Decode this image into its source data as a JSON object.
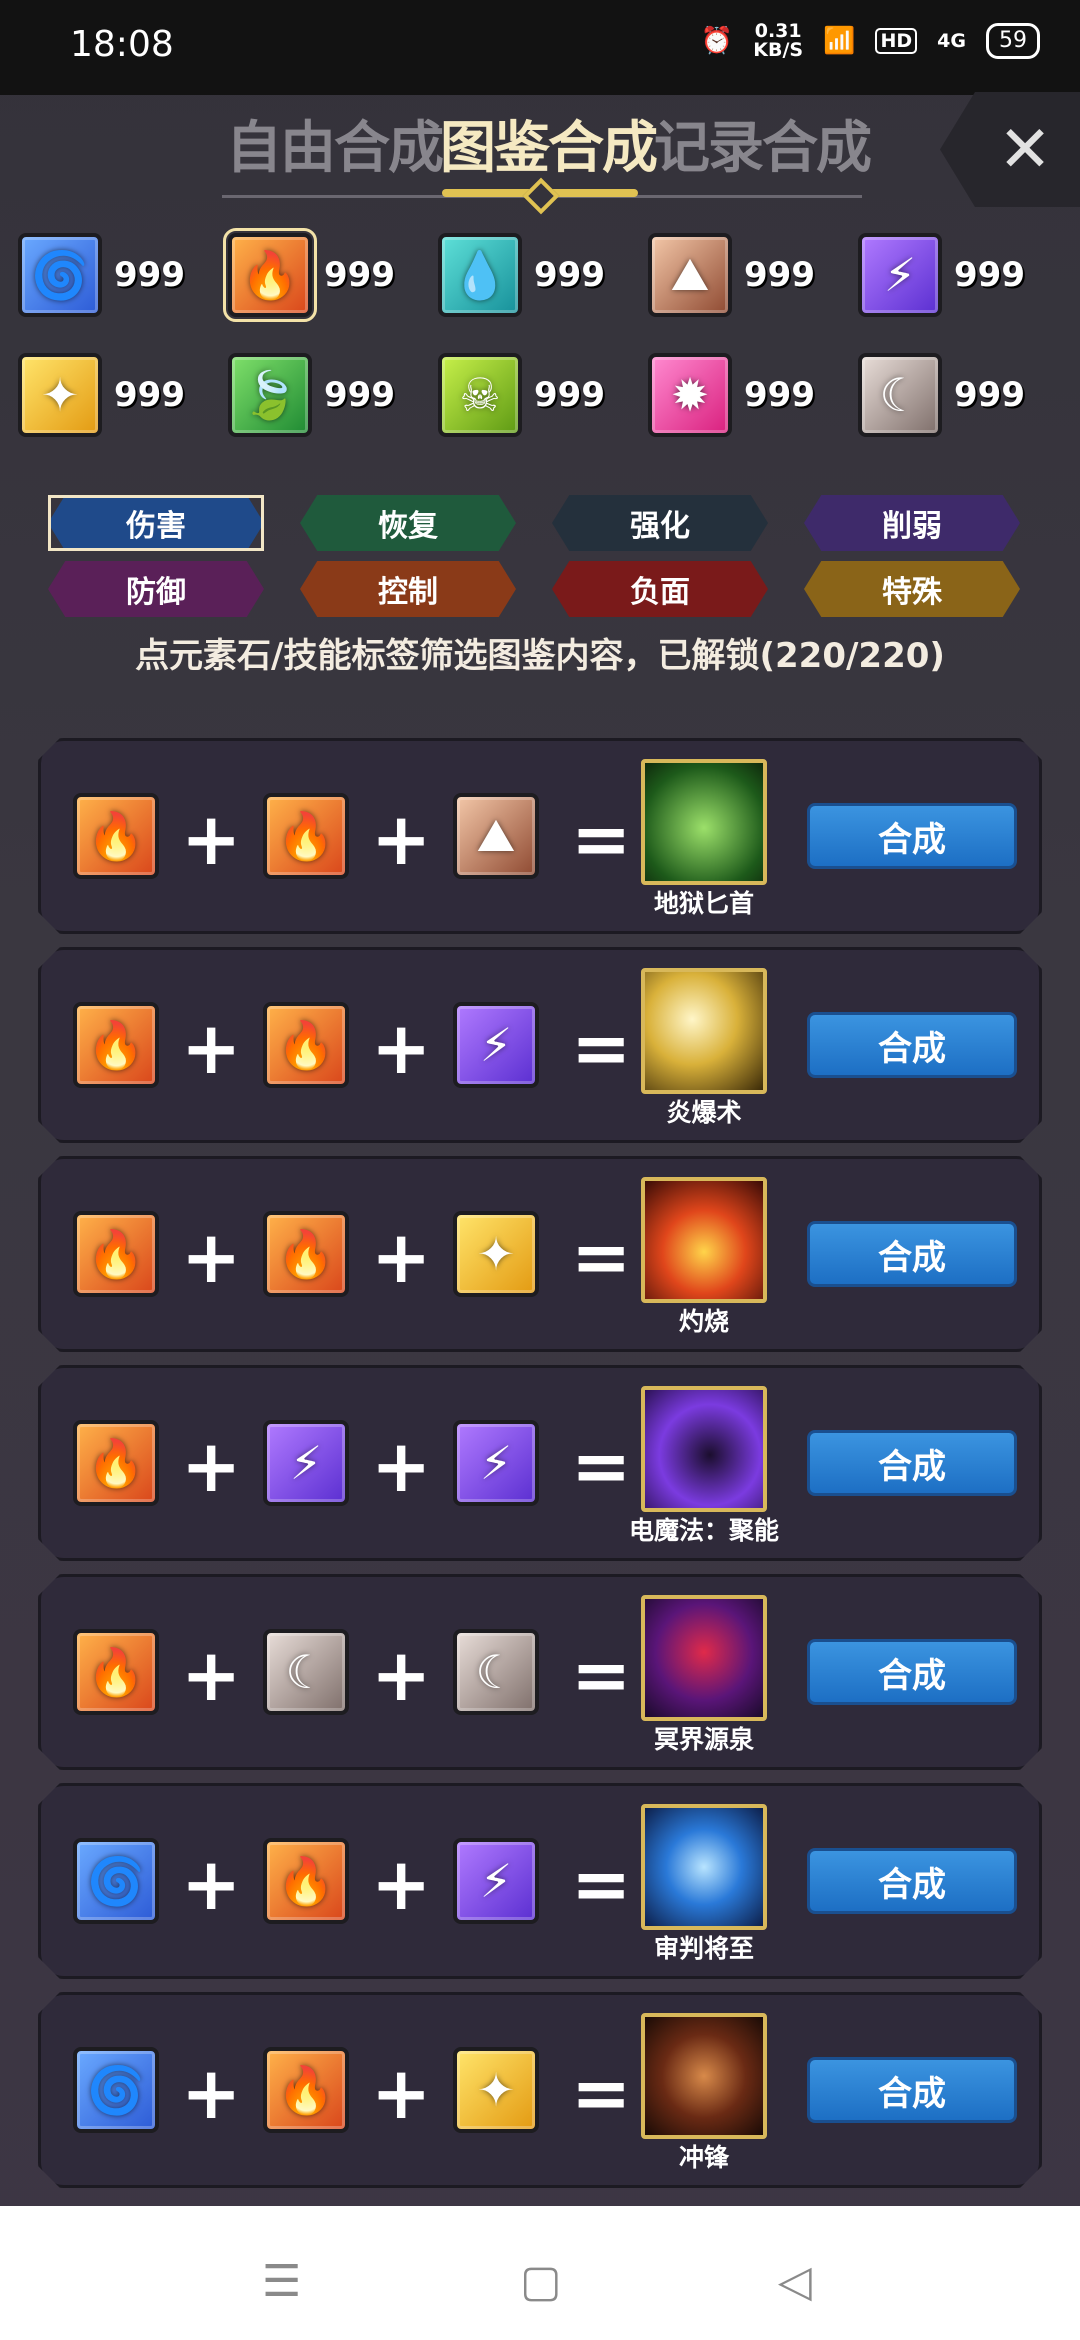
{
  "status_bar": {
    "time": "18:08",
    "net_speed_value": "0.31",
    "net_speed_unit": "KB/S",
    "hd": "HD",
    "signal": "4G",
    "battery": "59",
    "alarm_icon": "alarm-icon",
    "wifi_icon": "wifi-icon"
  },
  "tabs": [
    {
      "label": "自由合成",
      "active": false
    },
    {
      "label": "图鉴合成",
      "active": true
    },
    {
      "label": "记录合成",
      "active": false
    }
  ],
  "close_label": "✕",
  "inventory": [
    {
      "element": "wind",
      "glyph": "🌀",
      "count": "999"
    },
    {
      "element": "fire",
      "glyph": "🔥",
      "count": "999",
      "selected": true
    },
    {
      "element": "water",
      "glyph": "💧",
      "count": "999"
    },
    {
      "element": "earth",
      "glyph": "⛰",
      "count": "999"
    },
    {
      "element": "thunder",
      "glyph": "⚡",
      "count": "999"
    },
    {
      "element": "light",
      "glyph": "✦",
      "count": "999"
    },
    {
      "element": "leaf",
      "glyph": "🍃",
      "count": "999"
    },
    {
      "element": "poison",
      "glyph": "☠",
      "count": "999"
    },
    {
      "element": "holy",
      "glyph": "✹",
      "count": "999"
    },
    {
      "element": "moon",
      "glyph": "☾",
      "count": "999"
    }
  ],
  "tags": [
    {
      "label": "伤害",
      "color": "#1f4a8a",
      "selected": true
    },
    {
      "label": "恢复",
      "color": "#1f5a3c"
    },
    {
      "label": "强化",
      "color": "#24303c"
    },
    {
      "label": "削弱",
      "color": "#3e2a6a"
    },
    {
      "label": "防御",
      "color": "#5a2058"
    },
    {
      "label": "控制",
      "color": "#8a3a18"
    },
    {
      "label": "负面",
      "color": "#7a1a1a"
    },
    {
      "label": "特殊",
      "color": "#8a6418"
    }
  ],
  "hint": "点元素石/技能标签筛选图鉴内容，已解锁(220/220)",
  "recipes": [
    {
      "inputs": [
        "fire",
        "fire",
        "earth"
      ],
      "skill": "地狱匕首",
      "art": "s1",
      "button": "合成"
    },
    {
      "inputs": [
        "fire",
        "fire",
        "thunder"
      ],
      "skill": "炎爆术",
      "art": "s2",
      "button": "合成"
    },
    {
      "inputs": [
        "fire",
        "fire",
        "light"
      ],
      "skill": "灼烧",
      "art": "s3",
      "button": "合成"
    },
    {
      "inputs": [
        "fire",
        "thunder",
        "thunder"
      ],
      "skill": "电魔法：聚能",
      "art": "s4",
      "button": "合成"
    },
    {
      "inputs": [
        "fire",
        "moon",
        "moon"
      ],
      "skill": "冥界源泉",
      "art": "s5",
      "button": "合成"
    },
    {
      "inputs": [
        "wind",
        "fire",
        "thunder"
      ],
      "skill": "审判将至",
      "art": "s6",
      "button": "合成"
    },
    {
      "inputs": [
        "wind",
        "fire",
        "light"
      ],
      "skill": "冲锋",
      "art": "s7",
      "button": "合成"
    }
  ],
  "glyphs": {
    "wind": "🌀",
    "fire": "🔥",
    "water": "💧",
    "earth": "⛰",
    "thunder": "⚡",
    "light": "✦",
    "leaf": "🍃",
    "poison": "☠",
    "holy": "✹",
    "moon": "☾"
  },
  "nav": {
    "menu_icon": "☰",
    "home_icon": "▢",
    "back_icon": "◁"
  }
}
